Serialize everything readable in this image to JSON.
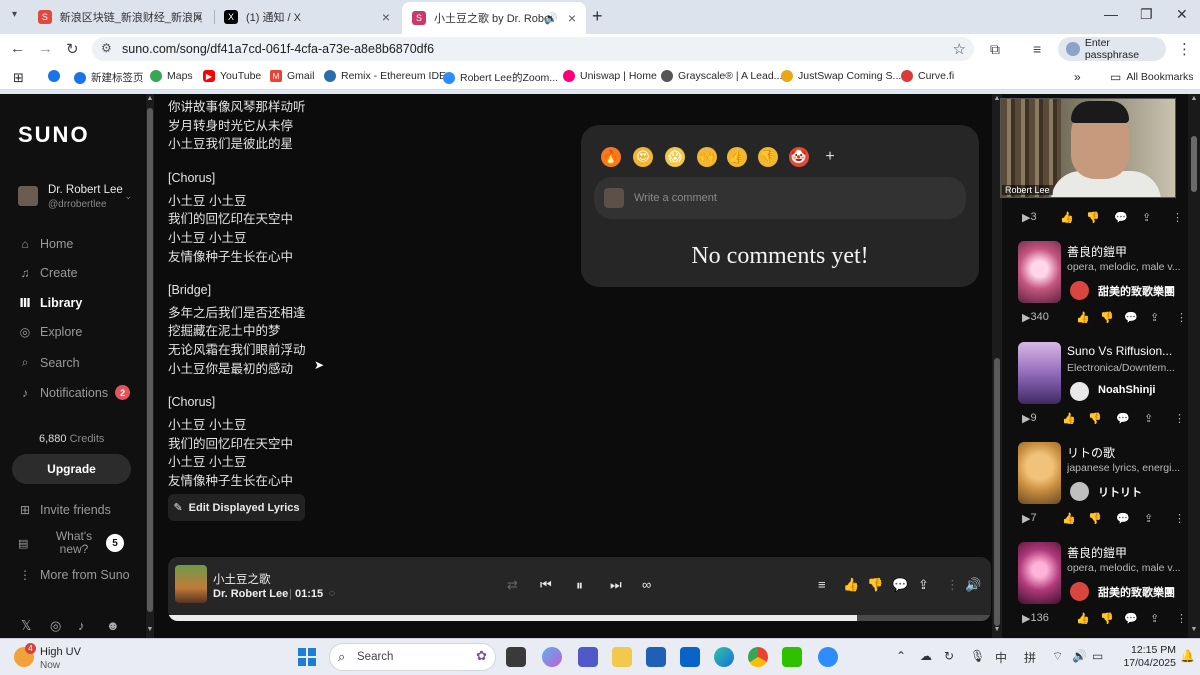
{
  "browser": {
    "tabs": [
      {
        "title": "新浪区块链_新浪财经_新浪网",
        "fav_color": "#e2483b",
        "fav_text": "S"
      },
      {
        "title": "(1) 通知 / X",
        "fav_color": "#000000",
        "fav_text": "X"
      },
      {
        "title": "小土豆之歌 by Dr. Robert Lee",
        "fav_color": "#c73a6a",
        "fav_text": "S"
      }
    ],
    "url": "suno.com/song/df41a7cd-061f-4cfa-a73e-a8e8b6870df6",
    "passphrase_label": "Enter passphrase",
    "bookmarks": [
      {
        "label": "新建标签页",
        "color": "#1a73e8"
      },
      {
        "label": "Maps",
        "color": "#34a853"
      },
      {
        "label": "YouTube",
        "color": "#ff0000"
      },
      {
        "label": "Gmail",
        "color": "#ea4335"
      },
      {
        "label": "Remix - Ethereum IDE",
        "color": "#2b6cb0"
      },
      {
        "label": "Robert Lee的Zoom...",
        "color": "#2d8cff"
      },
      {
        "label": "Uniswap | Home",
        "color": "#ff007a"
      },
      {
        "label": "Grayscale® | A Lead...",
        "color": "#555555"
      },
      {
        "label": "JustSwap Coming S...",
        "color": "#e6a817"
      },
      {
        "label": "Curve.fi",
        "color": "#d93b3b"
      }
    ],
    "all_bookmarks": "All Bookmarks"
  },
  "sidebar": {
    "logo": "SUNO",
    "profile_name": "Dr. Robert Lee",
    "profile_handle": "@drrobertlee",
    "nav": [
      {
        "label": "Home",
        "icon": "home-icon",
        "glyph": "⌂"
      },
      {
        "label": "Create",
        "icon": "music-note-icon",
        "glyph": "♫"
      },
      {
        "label": "Library",
        "icon": "library-icon",
        "glyph": "Ⅲ"
      },
      {
        "label": "Explore",
        "icon": "compass-icon",
        "glyph": "◎"
      },
      {
        "label": "Search",
        "icon": "search-icon",
        "glyph": "⌕"
      },
      {
        "label": "Notifications",
        "icon": "bell-icon",
        "glyph": "♪"
      }
    ],
    "notifications_count": "2",
    "credits_value": "6,880",
    "credits_label": "Credits",
    "upgrade": "Upgrade",
    "invite": "Invite friends",
    "whats_new": "What's new?",
    "whats_new_count": "5",
    "more": "More from Suno"
  },
  "lyrics": [
    "你讲故事像风琴那样动听",
    "岁月转身时光它从未停",
    "小土豆我们是彼此的星",
    "",
    "[Chorus]",
    "小土豆 小土豆",
    "我们的回忆印在天空中",
    "小土豆 小土豆",
    "友情像种子生长在心中",
    "",
    "[Bridge]",
    "多年之后我们是否还相逢",
    "挖掘藏在泥土中的梦",
    "无论风霜在我们眼前浮动",
    "小土豆你是最初的感动",
    "",
    "[Chorus]",
    "小土豆 小土豆",
    "我们的回忆印在天空中",
    "小土豆 小土豆",
    "友情像种子生长在心中"
  ],
  "edit_lyrics": "Edit Displayed Lyrics",
  "comments": {
    "reactions": [
      {
        "glyph": "🔥",
        "name": "fire-icon",
        "color": "#f57b21"
      },
      {
        "glyph": "😍",
        "name": "heart-eyes-icon",
        "color": "#f2b632"
      },
      {
        "glyph": "😱",
        "name": "scream-icon",
        "color": "#f2c84b"
      },
      {
        "glyph": "🙌",
        "name": "raised-hands-icon",
        "color": "#f2b632"
      },
      {
        "glyph": "👍",
        "name": "thumbs-up-icon",
        "color": "#f2b632"
      },
      {
        "glyph": "👎",
        "name": "thumbs-down-icon",
        "color": "#f2b632"
      },
      {
        "glyph": "🤡",
        "name": "clown-icon",
        "color": "#e2483b"
      }
    ],
    "placeholder": "Write a comment",
    "empty": "No comments yet!"
  },
  "player": {
    "title": "小土豆之歌",
    "artist": "Dr. Robert Lee",
    "time": "01:15",
    "progress": 0.837
  },
  "webcam_label": "Robert Lee",
  "right_list": {
    "top_plays": "3",
    "songs": [
      {
        "title": "善良的鎧甲",
        "tags": "opera, melodic, male v...",
        "artist": "甜美的致歌樂團",
        "plays": "340",
        "thumb": "#c4567f",
        "avatar": "#d9453f"
      },
      {
        "title": "Suno Vs Riffusion...",
        "tags": "Electronica/Downtem...",
        "artist": "NoahShinji",
        "plays": "9",
        "thumb": "#7b5aa6",
        "avatar": "#e8e8e8"
      },
      {
        "title": "リトの歌",
        "tags": "japanese lyrics, energi...",
        "artist": "リトリト",
        "plays": "7",
        "thumb": "#c98f3e",
        "avatar": "#bfbfbf"
      },
      {
        "title": "善良的鎧甲",
        "tags": "opera, melodic, male v...",
        "artist": "甜美的致歌樂團",
        "plays": "136",
        "thumb": "#b0397a",
        "avatar": "#d9453f"
      }
    ]
  },
  "taskbar": {
    "weather_title": "High UV",
    "weather_sub": "Now",
    "weather_badge": "4",
    "search": "Search",
    "time": "12:15 PM",
    "date": "17/04/2025",
    "ime": "中",
    "ime2": "拼"
  }
}
